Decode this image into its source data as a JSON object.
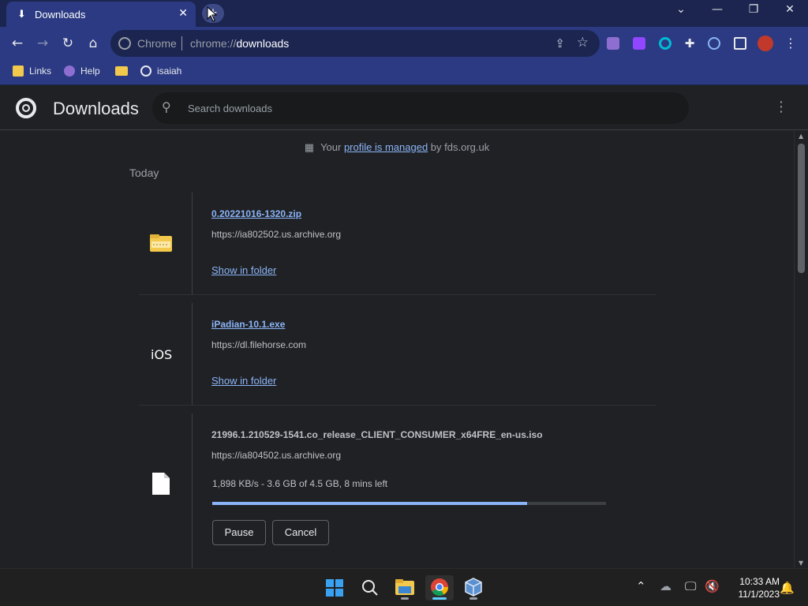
{
  "browser": {
    "tab": {
      "title": "Downloads",
      "icon": "download-icon"
    },
    "omnibox": {
      "site_label": "Chrome",
      "url_scheme": "chrome://",
      "url_path": "downloads"
    },
    "bookmarks": [
      {
        "label": "Links",
        "icon": "folder-icon",
        "color": "#f2c94c"
      },
      {
        "label": "Help",
        "icon": "help-icon",
        "color": "#8e6fd1"
      },
      {
        "label": "",
        "icon": "bookmark-app-icon",
        "color": "#f2c94c"
      },
      {
        "label": "isaiah",
        "icon": "globe-icon",
        "color": "#e8eaed"
      }
    ],
    "extensions": [
      {
        "icon": "bookmark-ext-icon",
        "color": "#8e6fd1"
      },
      {
        "icon": "twitch-ext-icon",
        "color": "#9146ff"
      },
      {
        "icon": "circle-ext-icon",
        "color": "#00bcd4"
      },
      {
        "icon": "puzzle-icon",
        "color": "#e8eaed"
      },
      {
        "icon": "download-progress-icon",
        "color": "#8ab4f8"
      },
      {
        "icon": "side-panel-icon",
        "color": "#e8eaed"
      },
      {
        "icon": "profile-avatar",
        "color": "#c0392b"
      }
    ]
  },
  "downloads_page": {
    "title": "Downloads",
    "search_placeholder": "Search downloads",
    "managed_notice": {
      "prefix": "Your ",
      "link": "profile is managed",
      "suffix": " by fds.org.uk"
    },
    "date_group": "Today",
    "items": [
      {
        "filename": "0.20221016-1320.zip",
        "url": "https://ia802502.us.archive.org",
        "action": "Show in folder",
        "icon": "zip-folder-icon"
      },
      {
        "filename": "iPadian-10.1.exe",
        "url": "https://dl.filehorse.com",
        "action": "Show in folder",
        "icon_text": "iOS"
      },
      {
        "filename": "21996.1.210529-1541.co_release_CLIENT_CONSUMER_x64FRE_en-us.iso",
        "url": "https://ia804502.us.archive.org",
        "status": "1,898 KB/s - 3.6 GB of 4.5 GB, 8 mins left",
        "progress": 0.8,
        "buttons": {
          "pause": "Pause",
          "cancel": "Cancel"
        },
        "icon": "file-icon"
      }
    ]
  },
  "taskbar": {
    "apps": [
      {
        "name": "start",
        "icon": "windows-start-icon"
      },
      {
        "name": "search",
        "icon": "search-icon"
      },
      {
        "name": "file-explorer",
        "icon": "folder-icon"
      },
      {
        "name": "chrome",
        "icon": "chrome-icon",
        "active": true
      },
      {
        "name": "virtualbox",
        "icon": "virtualbox-icon"
      }
    ],
    "clock": {
      "time": "10:33 AM",
      "date": "11/1/2023"
    }
  }
}
